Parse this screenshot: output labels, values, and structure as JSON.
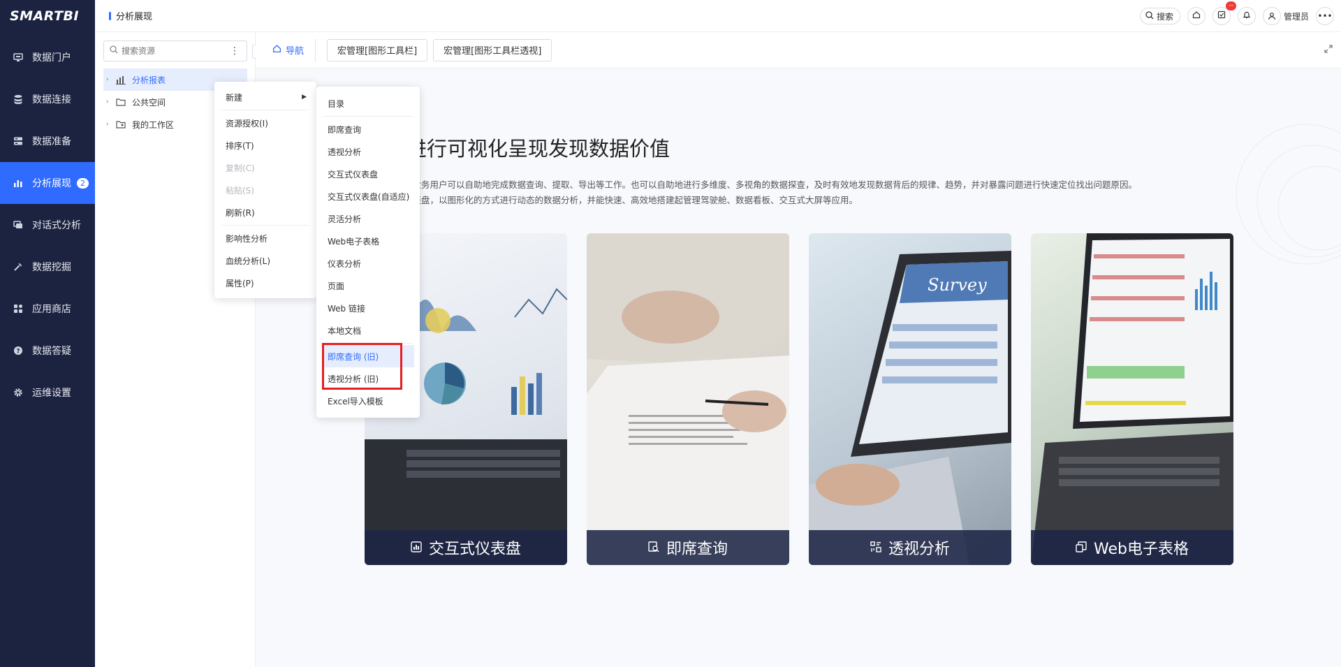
{
  "brand": {
    "logo": "SMARTBI"
  },
  "nav": {
    "items": [
      {
        "label": "数据门户",
        "icon": "monitor-icon"
      },
      {
        "label": "数据连接",
        "icon": "database-icon"
      },
      {
        "label": "数据准备",
        "icon": "server-icon"
      },
      {
        "label": "分析展现",
        "icon": "bar-chart-icon",
        "badge": "2",
        "active": true
      },
      {
        "label": "对话式分析",
        "icon": "chat-icon"
      },
      {
        "label": "数据挖掘",
        "icon": "pickaxe-icon"
      },
      {
        "label": "应用商店",
        "icon": "apps-icon"
      },
      {
        "label": "数据答疑",
        "icon": "question-icon"
      },
      {
        "label": "运维设置",
        "icon": "gear-icon"
      }
    ]
  },
  "header": {
    "title": "分析展现",
    "search_label": "搜索",
    "notification_badge": "--",
    "user_name": "管理员"
  },
  "resources": {
    "search_placeholder": "搜索资源",
    "tree": [
      {
        "label": "分析报表",
        "icon": "report-icon",
        "selected": true
      },
      {
        "label": "公共空间",
        "icon": "folder-icon"
      },
      {
        "label": "我的工作区",
        "icon": "workspace-icon"
      }
    ]
  },
  "tabs": {
    "nav_label": "导航",
    "items": [
      "宏管理[图形工具栏]",
      "宏管理[图形工具栏透视]"
    ]
  },
  "hero": {
    "title": "据进行可视化呈现发现数据价值",
    "desc_1": "模型，业务用户可以自助地完成数据查询、提取、导出等工作。也可以自助地进行多维度、多视角的数据探查，及时有效地发现数据背后的规律、趋势，并对暴露问题进行快速定位找出问题原因。",
    "desc_2": "互式仪表盘，以图形化的方式进行动态的数据分析，并能快速、高效地搭建起管理驾驶舱、数据看板、交互式大屏等应用。"
  },
  "cards": [
    {
      "label": "交互式仪表盘",
      "icon": "dashboard-icon"
    },
    {
      "label": "即席查询",
      "icon": "query-icon"
    },
    {
      "label": "透视分析",
      "icon": "pivot-icon"
    },
    {
      "label": "Web电子表格",
      "icon": "spreadsheet-icon"
    }
  ],
  "context_menu": {
    "new": "新建",
    "auth": "资源授权(I)",
    "sort": "排序(T)",
    "copy": "复制(C)",
    "paste": "粘贴(S)",
    "refresh": "刷新(R)",
    "impact": "影响性分析",
    "lineage": "血统分析(L)",
    "props": "属性(P)"
  },
  "sub_menu": {
    "items": [
      "目录",
      "即席查询",
      "透视分析",
      "交互式仪表盘",
      "交互式仪表盘(自适应)",
      "灵活分析",
      "Web电子表格",
      "仪表分析",
      "页面",
      "Web 链接",
      "本地文档",
      "即席查询 (旧)",
      "透视分析 (旧)",
      "Excel导入模板"
    ]
  }
}
